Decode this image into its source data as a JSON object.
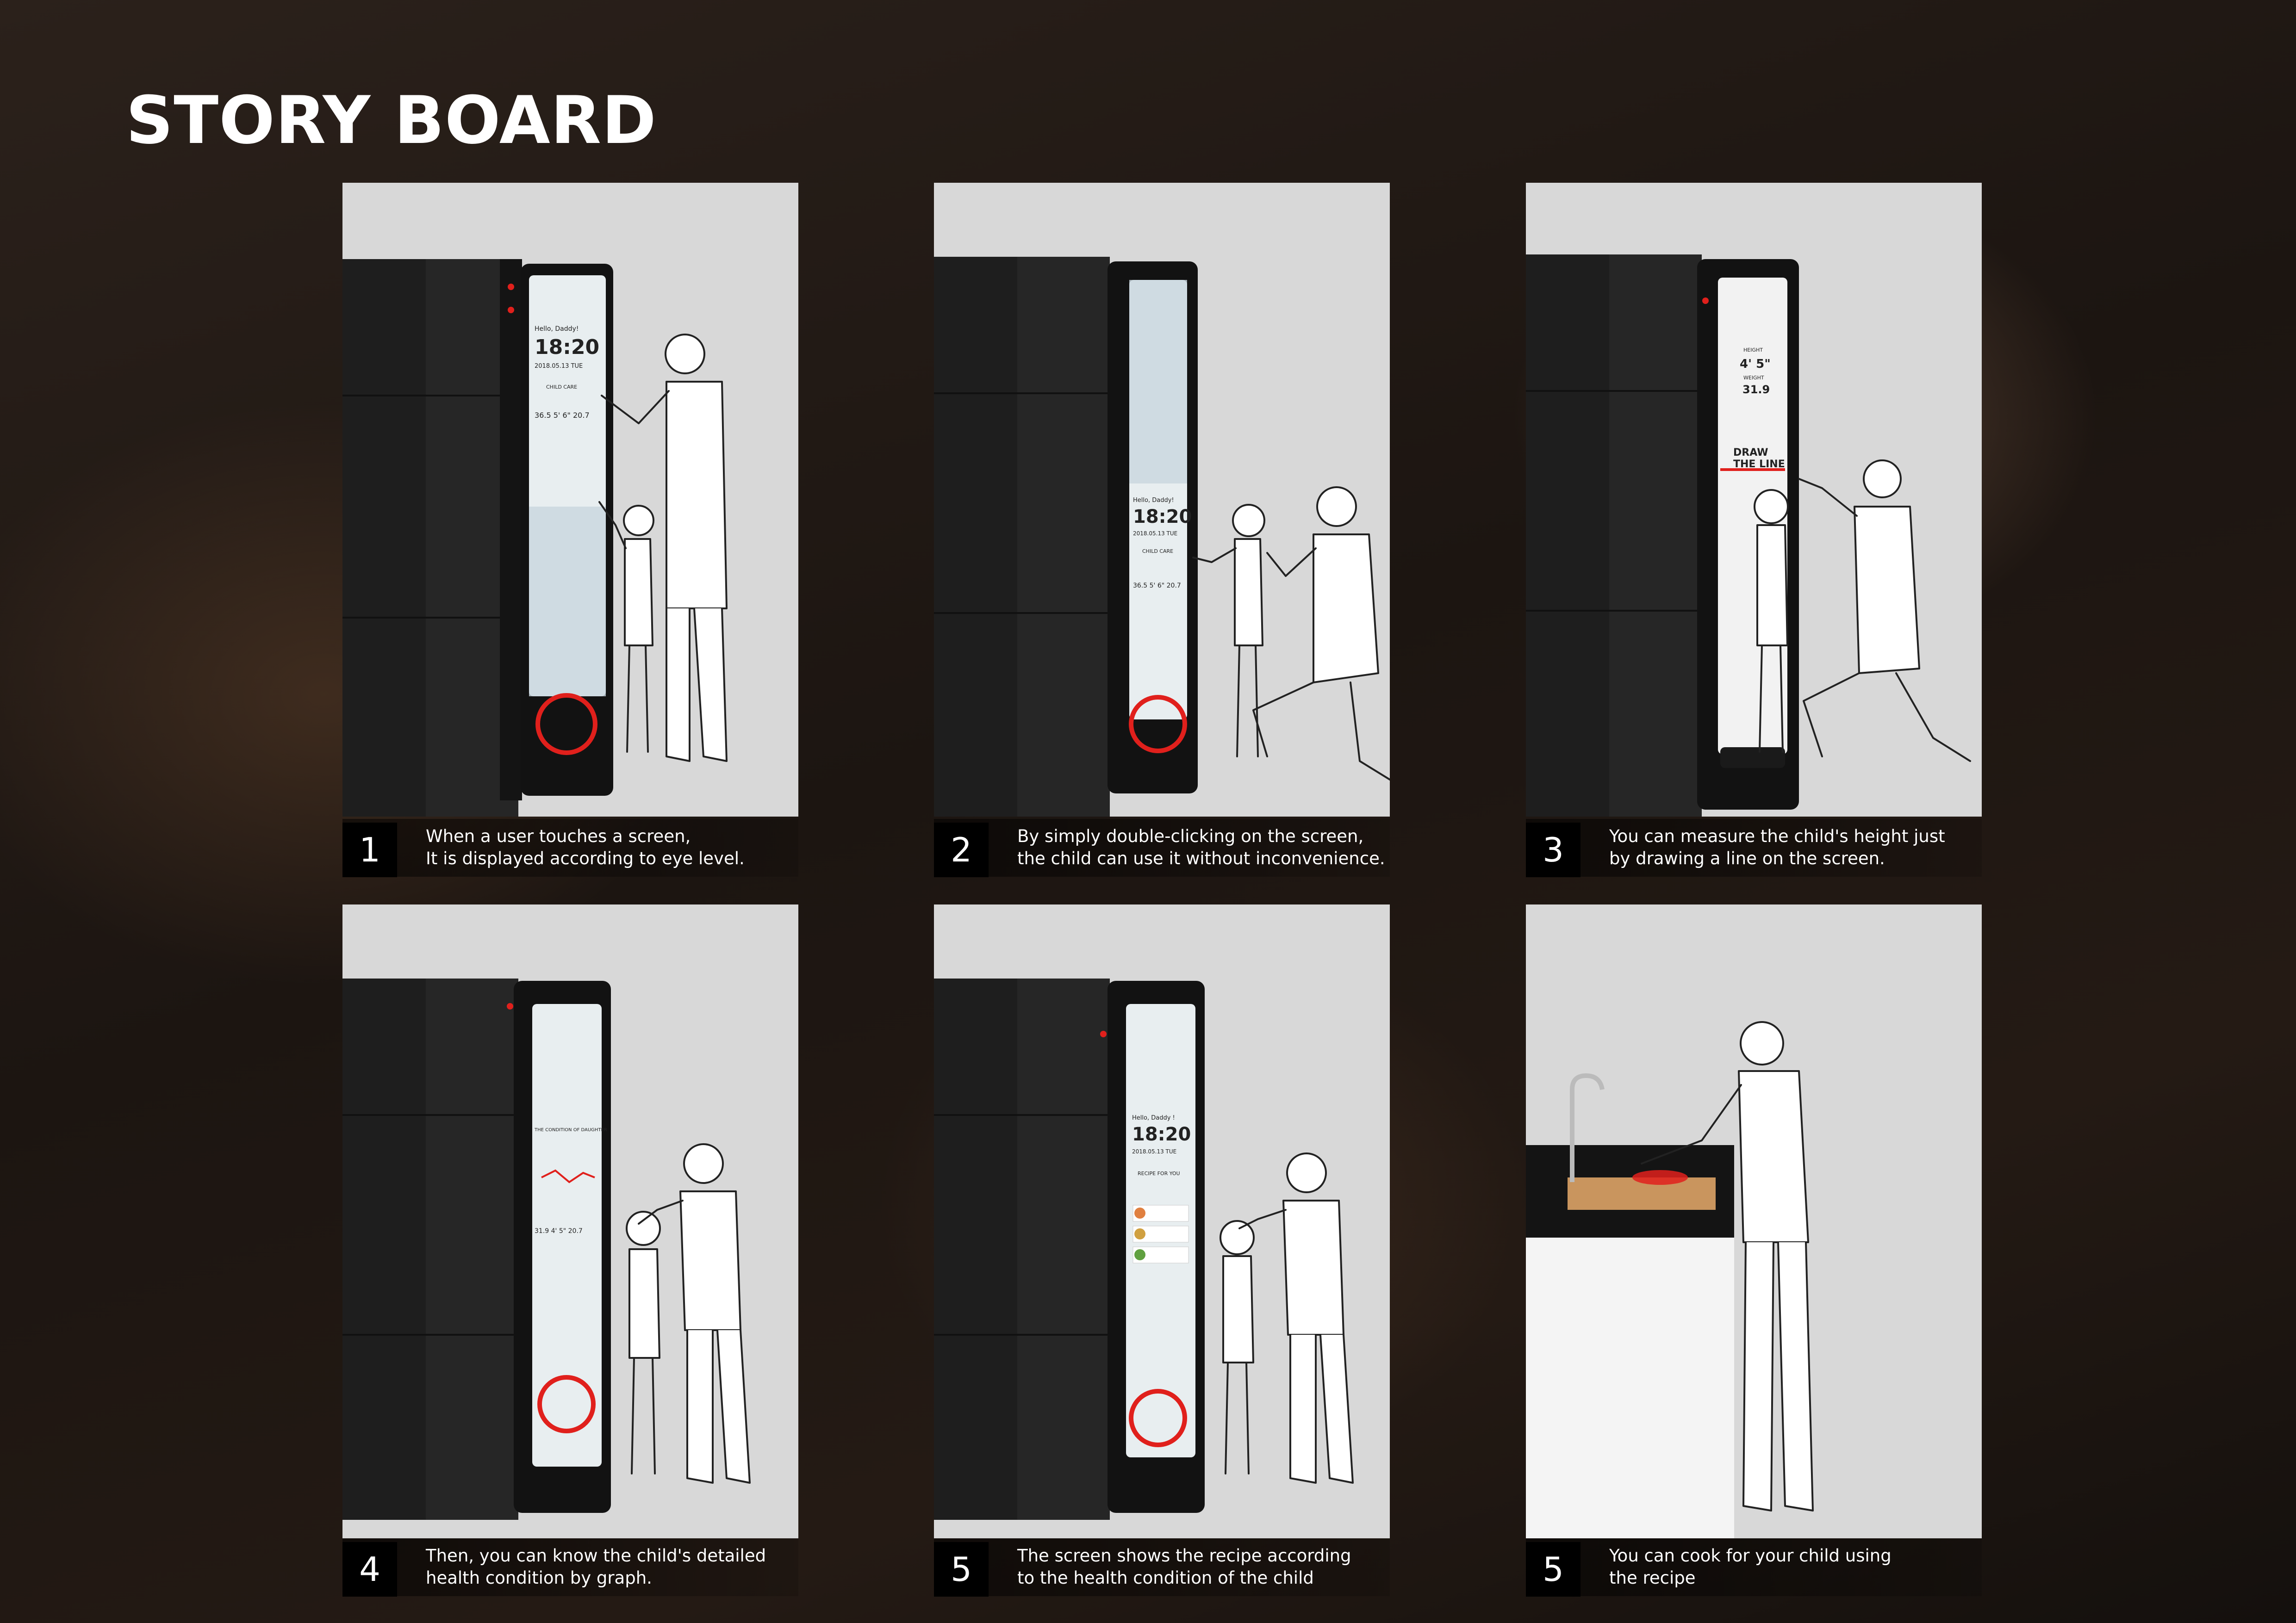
{
  "title": "STORY BOARD",
  "panels": [
    {
      "num": "1",
      "lines": [
        "When a user touches a screen,",
        "It is displayed according to eye level."
      ],
      "screen": {
        "greeting": "Hello, Daddy!",
        "time": "18:20",
        "date": "2018.05.13 TUE",
        "section": "CHILD CARE",
        "stats": "36.5  5' 6\"  20.7"
      }
    },
    {
      "num": "2",
      "lines": [
        "By simply double-clicking on the screen,",
        "the child can use it without inconvenience."
      ],
      "screen": {
        "greeting": "Hello, Daddy!",
        "time": "18:20",
        "date": "2018.05.13 TUE",
        "section": "CHILD CARE",
        "stats": "36.5  5' 6\"  20.7"
      }
    },
    {
      "num": "3",
      "lines": [
        "You can measure the child's height just",
        "by drawing a line on the screen."
      ],
      "screen": {
        "height_label": "HEIGHT",
        "height_value": "4' 5\"",
        "weight_label": "WEIGHT",
        "weight_value": "31.9",
        "draw_line_1": "DRAW",
        "draw_line_2": "THE LINE"
      }
    },
    {
      "num": "4",
      "lines": [
        "Then, you can know the child's detailed",
        "health condition by graph."
      ],
      "screen": {
        "heading": "THE CONDITION OF DAUGHTER",
        "stats": "31.9  4' 5\"  20.7"
      }
    },
    {
      "num": "5",
      "lines": [
        "The screen shows the recipe according",
        "to the health condition of the child"
      ],
      "screen": {
        "greeting": "Hello, Daddy !",
        "time": "18:20",
        "date": "2018.05.13 TUE",
        "section": "RECIPE FOR YOU"
      }
    },
    {
      "num": "5",
      "lines": [
        "You can cook for your child using",
        "the recipe"
      ]
    }
  ],
  "colors": {
    "accent_red": "#e0201c",
    "fridge_dark": "#1e1e1e",
    "panel_bg": "#d8d8d8"
  }
}
